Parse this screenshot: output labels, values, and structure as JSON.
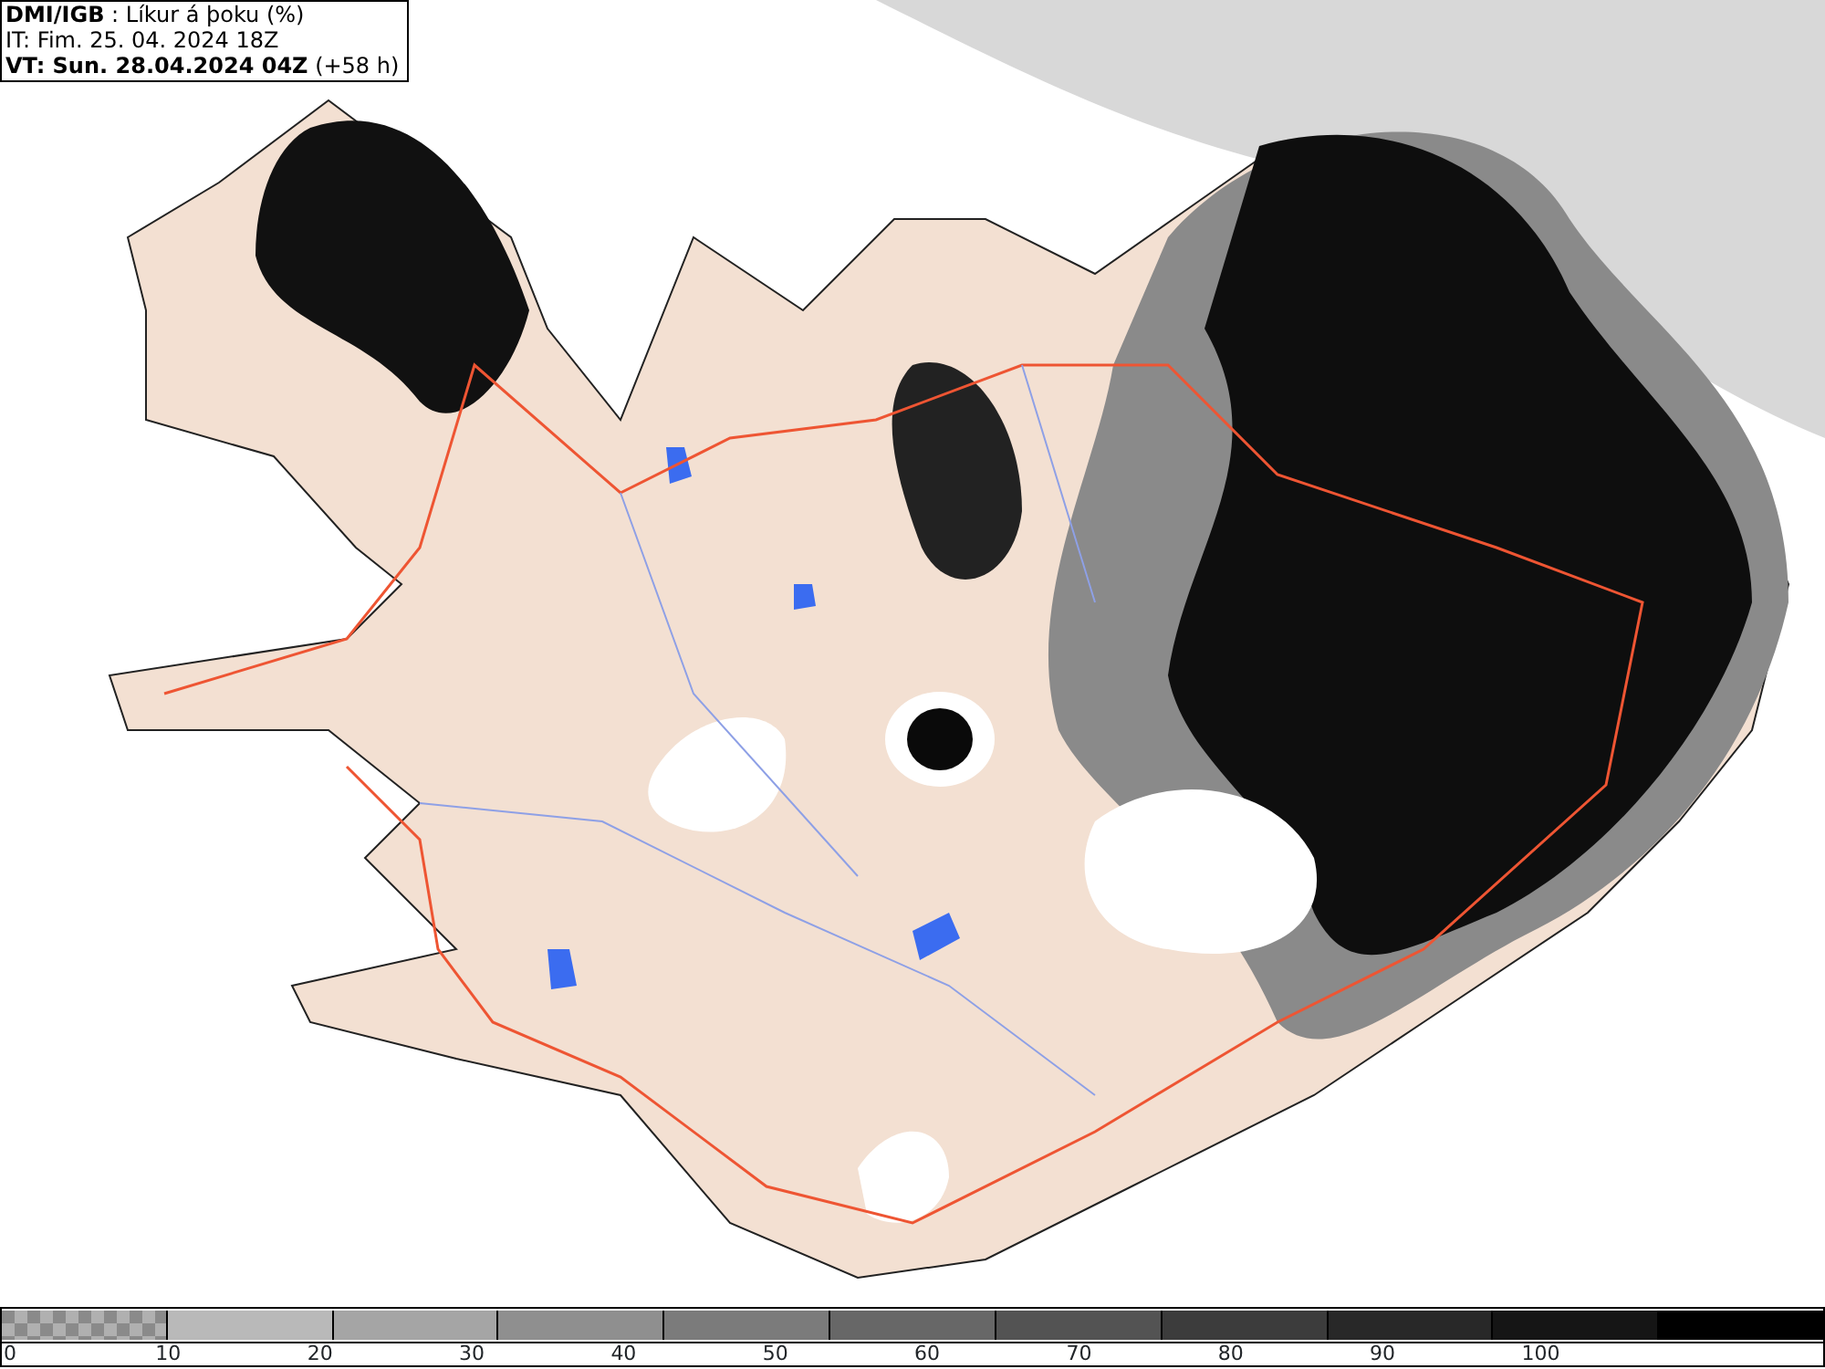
{
  "header": {
    "lines": [
      "**DMI/IGB** : Líkur á þoku (%)",
      "IT: Fim. 25. 04. 2024 18Z",
      "**VT: Sun. 28.04.2024 04Z** (+58 h)"
    ]
  },
  "legend": {
    "segments": [
      {
        "kind": "checker"
      },
      {
        "kind": "solid",
        "color": "#b9b9b9"
      },
      {
        "kind": "solid",
        "color": "#a5a5a5"
      },
      {
        "kind": "solid",
        "color": "#8f8f8f"
      },
      {
        "kind": "solid",
        "color": "#7b7b7b"
      },
      {
        "kind": "solid",
        "color": "#676767"
      },
      {
        "kind": "solid",
        "color": "#535353"
      },
      {
        "kind": "solid",
        "color": "#3c3c3c"
      },
      {
        "kind": "solid",
        "color": "#282828"
      },
      {
        "kind": "solid",
        "color": "#151515"
      },
      {
        "kind": "solid",
        "color": "#000000"
      }
    ],
    "ticks": [
      "0",
      "10",
      "20",
      "30",
      "40",
      "50",
      "60",
      "70",
      "80",
      "90",
      "100"
    ]
  }
}
